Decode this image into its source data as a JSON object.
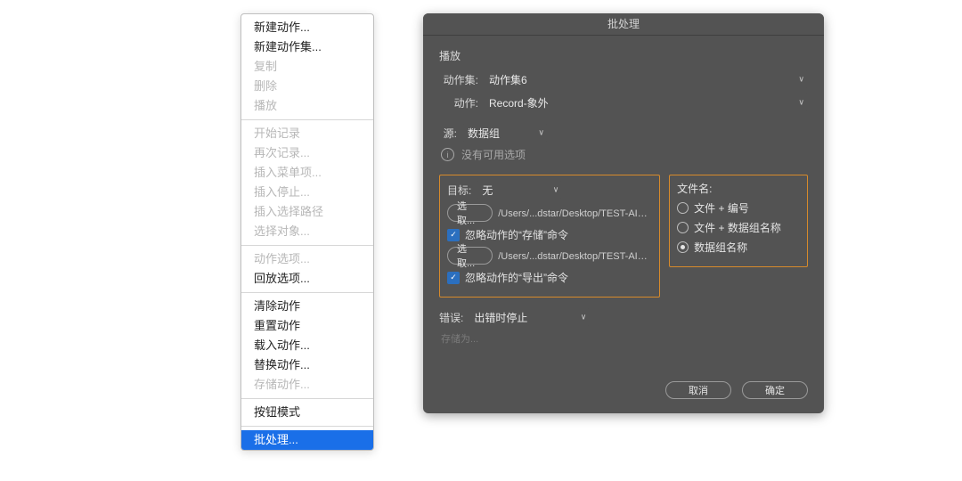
{
  "context_menu": {
    "groups": [
      [
        {
          "label": "新建动作...",
          "enabled": true
        },
        {
          "label": "新建动作集...",
          "enabled": true
        },
        {
          "label": "复制",
          "enabled": false
        },
        {
          "label": "删除",
          "enabled": false
        },
        {
          "label": "播放",
          "enabled": false
        }
      ],
      [
        {
          "label": "开始记录",
          "enabled": false
        },
        {
          "label": "再次记录...",
          "enabled": false
        },
        {
          "label": "插入菜单项...",
          "enabled": false
        },
        {
          "label": "插入停止...",
          "enabled": false
        },
        {
          "label": "插入选择路径",
          "enabled": false
        },
        {
          "label": "选择对象...",
          "enabled": false
        }
      ],
      [
        {
          "label": "动作选项...",
          "enabled": false
        },
        {
          "label": "回放选项...",
          "enabled": true
        }
      ],
      [
        {
          "label": "清除动作",
          "enabled": true
        },
        {
          "label": "重置动作",
          "enabled": true
        },
        {
          "label": "载入动作...",
          "enabled": true
        },
        {
          "label": "替换动作...",
          "enabled": true
        },
        {
          "label": "存储动作...",
          "enabled": false
        }
      ],
      [
        {
          "label": "按钮模式",
          "enabled": true
        }
      ],
      [
        {
          "label": "批处理...",
          "enabled": true,
          "selected": true
        }
      ]
    ]
  },
  "dialog": {
    "title": "批处理",
    "play_section": "播放",
    "action_set_label": "动作集:",
    "action_set_value": "动作集6",
    "action_label": "动作:",
    "action_value": "Record-象外",
    "source_label": "源:",
    "source_value": "数据组",
    "info_text": "没有可用选项",
    "dest_label": "目标:",
    "dest_value": "无",
    "choose_btn": "选取...",
    "path_text": "/Users/...dstar/Desktop/TEST-AI-象外",
    "override_save": "忽略动作的“存储”命令",
    "override_export": "忽略动作的“导出”命令",
    "filename_label": "文件名:",
    "radio_file_number": "文件 + 编号",
    "radio_file_dataset": "文件 + 数据组名称",
    "radio_dataset": "数据组名称",
    "error_label": "错误:",
    "error_value": "出错时停止",
    "saveas_placeholder": "存储为...",
    "cancel_btn": "取消",
    "ok_btn": "确定"
  }
}
